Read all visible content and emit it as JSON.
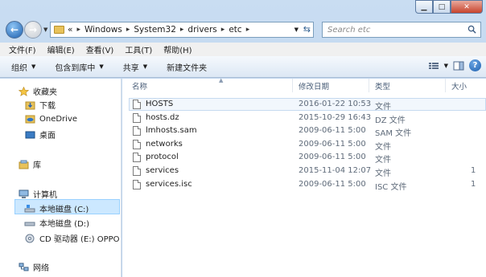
{
  "address": {
    "overflow": "«",
    "crumbs": [
      "Windows",
      "System32",
      "drivers",
      "etc"
    ]
  },
  "search": {
    "placeholder": "Search etc"
  },
  "menu": [
    "文件(F)",
    "编辑(E)",
    "查看(V)",
    "工具(T)",
    "帮助(H)"
  ],
  "toolbar": {
    "organize": "组织",
    "include_in_library": "包含到库中",
    "share": "共享",
    "new_folder": "新建文件夹"
  },
  "nav": {
    "favorites": "收藏夹",
    "downloads": "下载",
    "onedrive": "OneDrive",
    "desktop": "桌面",
    "libraries": "库",
    "computer": "计算机",
    "drive_c": "本地磁盘 (C:)",
    "drive_d": "本地磁盘 (D:)",
    "drive_e": "CD 驱动器 (E:) OPPO D",
    "network": "网络"
  },
  "columns": {
    "name": "名称",
    "date": "修改日期",
    "type": "类型",
    "size": "大小"
  },
  "files": [
    {
      "name": "HOSTS",
      "date": "2016-01-22 10:53",
      "type": "文件",
      "size": ""
    },
    {
      "name": "hosts.dz",
      "date": "2015-10-29 16:43",
      "type": "DZ 文件",
      "size": ""
    },
    {
      "name": "lmhosts.sam",
      "date": "2009-06-11 5:00",
      "type": "SAM 文件",
      "size": ""
    },
    {
      "name": "networks",
      "date": "2009-06-11 5:00",
      "type": "文件",
      "size": ""
    },
    {
      "name": "protocol",
      "date": "2009-06-11 5:00",
      "type": "文件",
      "size": ""
    },
    {
      "name": "services",
      "date": "2015-11-04 12:07",
      "type": "文件",
      "size": "1"
    },
    {
      "name": "services.isc",
      "date": "2009-06-11 5:00",
      "type": "ISC 文件",
      "size": "1"
    }
  ],
  "colors": {
    "selection": "#cce8ff",
    "window_frame": "#b7cfea",
    "accent": "#1d5fae"
  }
}
